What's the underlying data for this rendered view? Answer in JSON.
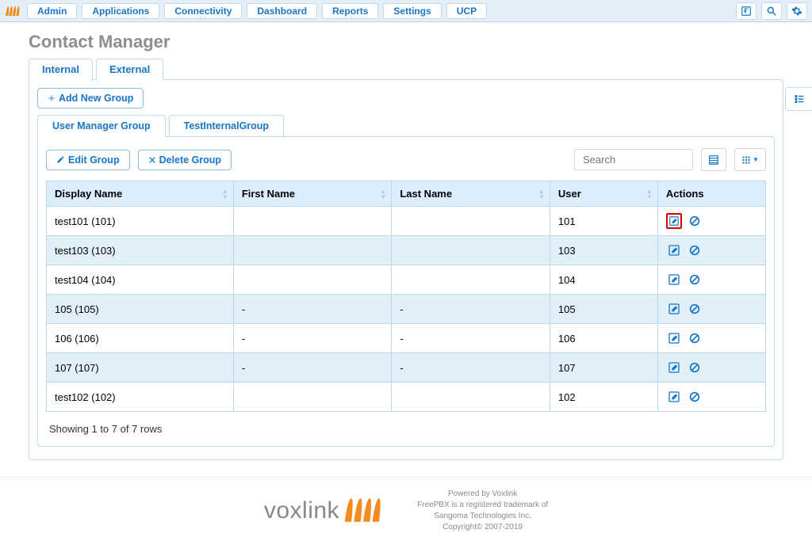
{
  "menu": {
    "items": [
      "Admin",
      "Applications",
      "Connectivity",
      "Dashboard",
      "Reports",
      "Settings",
      "UCP"
    ]
  },
  "page": {
    "title": "Contact Manager"
  },
  "outerTabs": [
    {
      "label": "Internal",
      "active": true
    },
    {
      "label": "External",
      "active": false
    }
  ],
  "buttons": {
    "addNewGroup": "Add New Group",
    "editGroup": "Edit Group",
    "deleteGroup": "Delete Group"
  },
  "innerTabs": [
    {
      "label": "User Manager Group",
      "active": true
    },
    {
      "label": "TestInternalGroup",
      "active": false
    }
  ],
  "search": {
    "placeholder": "Search"
  },
  "columns": [
    "Display Name",
    "First Name",
    "Last Name",
    "User",
    "Actions"
  ],
  "rows": [
    {
      "display": "test101 (101)",
      "first": "",
      "last": "",
      "user": "101",
      "highlight": true
    },
    {
      "display": "test103 (103)",
      "first": "",
      "last": "",
      "user": "103",
      "highlight": false
    },
    {
      "display": "test104 (104)",
      "first": "",
      "last": "",
      "user": "104",
      "highlight": false
    },
    {
      "display": "105 (105)",
      "first": "-",
      "last": "-",
      "user": "105",
      "highlight": false
    },
    {
      "display": "106 (106)",
      "first": "-",
      "last": "-",
      "user": "106",
      "highlight": false
    },
    {
      "display": "107 (107)",
      "first": "-",
      "last": "-",
      "user": "107",
      "highlight": false
    },
    {
      "display": "test102 (102)",
      "first": "",
      "last": "",
      "user": "102",
      "highlight": false
    }
  ],
  "rowsInfo": "Showing 1 to 7 of 7 rows",
  "footer": {
    "logoText": "voxlink",
    "line1": "Powered by Voxlink",
    "line2": "FreePBX is a registered trademark of",
    "line3": "Sangoma Technologies Inc.",
    "line4": "Copyright© 2007-2019"
  },
  "colors": {
    "accent": "#1976c7",
    "headerBg": "#dceefb",
    "rowAlt": "#e1eff9",
    "highlight": "#d60000",
    "orange": "#f58b1f"
  }
}
